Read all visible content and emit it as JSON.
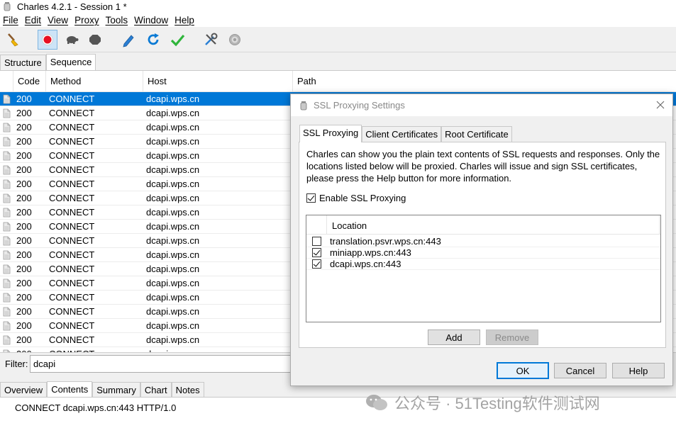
{
  "window": {
    "title": "Charles 4.2.1 - Session 1 *"
  },
  "menu": [
    "File",
    "Edit",
    "View",
    "Proxy",
    "Tools",
    "Window",
    "Help"
  ],
  "toolbar": {
    "buttons": [
      "broom-icon",
      "record-icon",
      "turtle-icon",
      "stop-icon",
      "pen-icon",
      "refresh-icon",
      "check-icon",
      "tools-icon",
      "gear-icon"
    ]
  },
  "view_tabs": [
    "Structure",
    "Sequence"
  ],
  "table": {
    "columns": [
      "Code",
      "Method",
      "Host",
      "Path"
    ],
    "rows": [
      {
        "code": "200",
        "method": "CONNECT",
        "host": "dcapi.wps.cn"
      },
      {
        "code": "200",
        "method": "CONNECT",
        "host": "dcapi.wps.cn"
      },
      {
        "code": "200",
        "method": "CONNECT",
        "host": "dcapi.wps.cn"
      },
      {
        "code": "200",
        "method": "CONNECT",
        "host": "dcapi.wps.cn"
      },
      {
        "code": "200",
        "method": "CONNECT",
        "host": "dcapi.wps.cn"
      },
      {
        "code": "200",
        "method": "CONNECT",
        "host": "dcapi.wps.cn"
      },
      {
        "code": "200",
        "method": "CONNECT",
        "host": "dcapi.wps.cn"
      },
      {
        "code": "200",
        "method": "CONNECT",
        "host": "dcapi.wps.cn"
      },
      {
        "code": "200",
        "method": "CONNECT",
        "host": "dcapi.wps.cn"
      },
      {
        "code": "200",
        "method": "CONNECT",
        "host": "dcapi.wps.cn"
      },
      {
        "code": "200",
        "method": "CONNECT",
        "host": "dcapi.wps.cn"
      },
      {
        "code": "200",
        "method": "CONNECT",
        "host": "dcapi.wps.cn"
      },
      {
        "code": "200",
        "method": "CONNECT",
        "host": "dcapi.wps.cn"
      },
      {
        "code": "200",
        "method": "CONNECT",
        "host": "dcapi.wps.cn"
      },
      {
        "code": "200",
        "method": "CONNECT",
        "host": "dcapi.wps.cn"
      },
      {
        "code": "200",
        "method": "CONNECT",
        "host": "dcapi.wps.cn"
      },
      {
        "code": "200",
        "method": "CONNECT",
        "host": "dcapi.wps.cn"
      },
      {
        "code": "200",
        "method": "CONNECT",
        "host": "dcapi.wps.cn"
      },
      {
        "code": "200",
        "method": "CONNECT",
        "host": "dcapi.wps.cn"
      }
    ]
  },
  "filter": {
    "label": "Filter:",
    "value": "dcapi"
  },
  "detail_tabs": [
    "Overview",
    "Contents",
    "Summary",
    "Chart",
    "Notes"
  ],
  "detail": {
    "text": "CONNECT dcapi.wps.cn:443 HTTP/1.0"
  },
  "dialog": {
    "title": "SSL Proxying Settings",
    "tabs": [
      "SSL Proxying",
      "Client Certificates",
      "Root Certificate"
    ],
    "description": "Charles can show you the plain text contents of SSL requests and responses. Only the locations listed below will be proxied. Charles will issue and sign SSL certificates, please press the Help button for more information.",
    "enable_label": "Enable SSL Proxying",
    "enable_checked": true,
    "location_header": "Location",
    "locations": [
      {
        "location": "translation.psvr.wps.cn:443",
        "checked": false
      },
      {
        "location": "miniapp.wps.cn:443",
        "checked": true
      },
      {
        "location": "dcapi.wps.cn:443",
        "checked": true
      }
    ],
    "add_label": "Add",
    "remove_label": "Remove",
    "ok_label": "OK",
    "cancel_label": "Cancel",
    "help_label": "Help"
  },
  "watermark": {
    "text": "公众号 · 51Testing软件测试网"
  },
  "colors": {
    "selection": "#0078d7",
    "record": "#e81123",
    "refresh": "#0a7ad4",
    "check": "#2fb53b"
  }
}
